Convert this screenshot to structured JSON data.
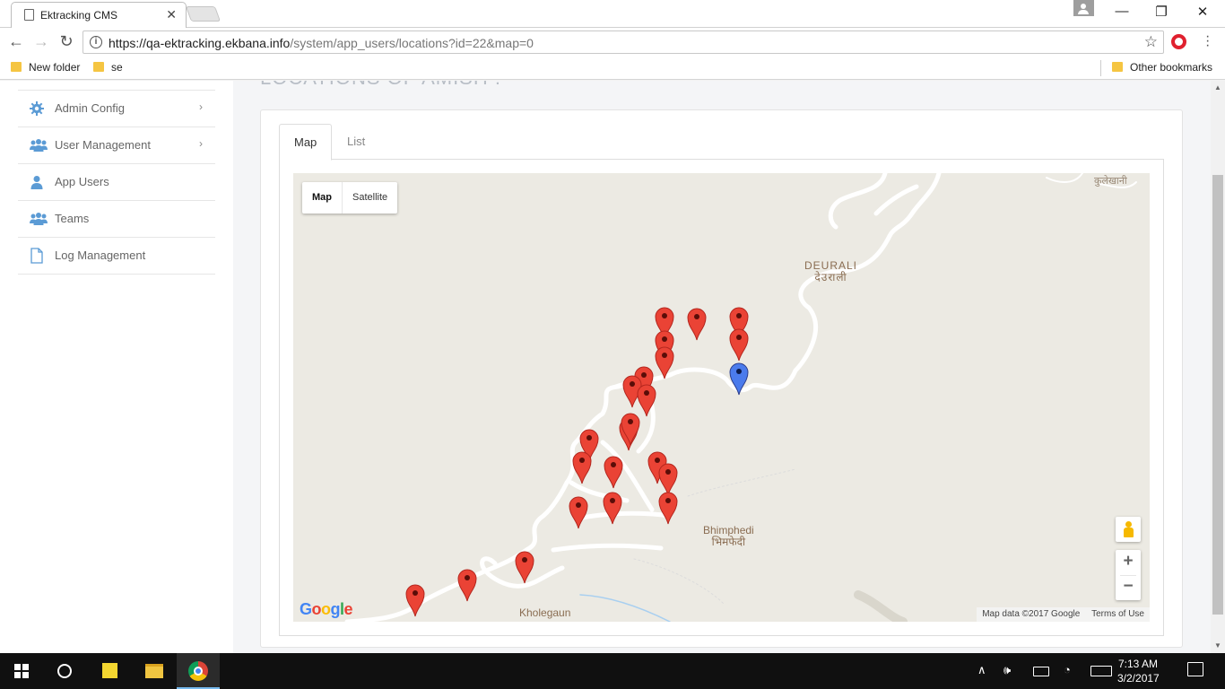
{
  "browser": {
    "tab_title": "Ektracking CMS",
    "tab_close": "✕",
    "window_controls": {
      "minimize": "—",
      "maximize": "❐",
      "close": "✕"
    },
    "url_host": "https://qa-ektracking.ekbana.info",
    "url_path": "/system/app_users/locations?id=22&map=0",
    "bookmarks": [
      "New folder",
      "se"
    ],
    "other_bookmarks": "Other bookmarks"
  },
  "page": {
    "title": "LOCATIONS OF AMISH :"
  },
  "sidebar": {
    "items": [
      {
        "label": "Admin Config",
        "icon": "gear-icon",
        "has_submenu": true,
        "chevron": "›"
      },
      {
        "label": "User Management",
        "icon": "users-icon",
        "has_submenu": true,
        "chevron": "›"
      },
      {
        "label": "App Users",
        "icon": "user-icon",
        "has_submenu": false
      },
      {
        "label": "Teams",
        "icon": "users-icon",
        "has_submenu": false
      },
      {
        "label": "Log Management",
        "icon": "document-icon",
        "has_submenu": false
      }
    ]
  },
  "tabs": {
    "map": "Map",
    "list": "List",
    "active": "Map"
  },
  "map": {
    "type_buttons": {
      "map": "Map",
      "satellite": "Satellite",
      "active": "Map"
    },
    "places": {
      "deurali_en": "DEURALI",
      "deurali_ne": "देउराली",
      "bhimphedi_en": "Bhimphedi",
      "bhimphedi_ne": "भिमफेदी",
      "kholegaun": "Kholegaun",
      "kulekhani": "कुलेखानी"
    },
    "zoom_in": "+",
    "zoom_out": "−",
    "logo": "Google",
    "attribution": "Map data ©2017 Google",
    "terms": "Terms of Use",
    "colors": {
      "marker": "#ea4335",
      "current_marker": "#4b7bec",
      "road": "#ffffff",
      "land": "#eceae3"
    }
  },
  "taskbar": {
    "time": "7:13 AM",
    "date": "3/2/2017"
  }
}
